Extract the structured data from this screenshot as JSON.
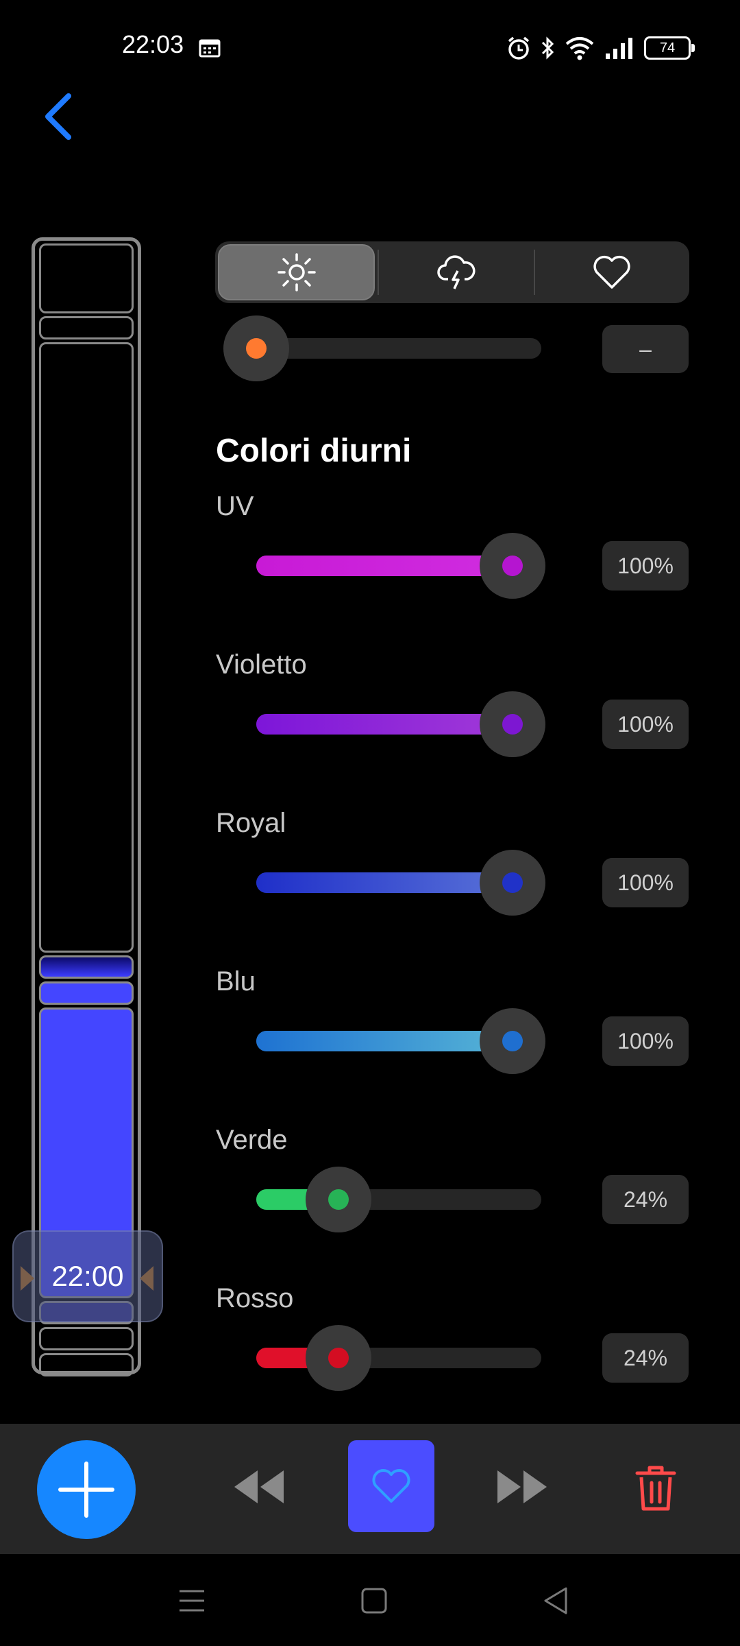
{
  "status_bar": {
    "time": "22:03",
    "battery": "74"
  },
  "timeline": {
    "current_time": "22:00"
  },
  "tabs": [
    {
      "icon": "sun-icon",
      "active": true
    },
    {
      "icon": "storm-icon",
      "active": false
    },
    {
      "icon": "heart-icon",
      "active": false
    }
  ],
  "top_slider": {
    "value": "–",
    "knob_color": "#ff7a30"
  },
  "section_title": "Colori diurni",
  "channels": [
    {
      "label": "UV",
      "value": "100%",
      "fraction": 1.0,
      "color_start": "#c81ad6",
      "color_end": "#d02de0",
      "knob_color": "#b515d0"
    },
    {
      "label": "Violetto",
      "value": "100%",
      "fraction": 1.0,
      "color_start": "#7d16d9",
      "color_end": "#a23ad8",
      "knob_color": "#7d17d2"
    },
    {
      "label": "Royal",
      "value": "100%",
      "fraction": 1.0,
      "color_start": "#1f2fc9",
      "color_end": "#5a73d8",
      "knob_color": "#2032c8"
    },
    {
      "label": "Blu",
      "value": "100%",
      "fraction": 1.0,
      "color_start": "#1e72d2",
      "color_end": "#58b6d6",
      "knob_color": "#1f6fd0"
    },
    {
      "label": "Verde",
      "value": "24%",
      "fraction": 0.24,
      "color_start": "#2bcc66",
      "color_end": "#2bcc66",
      "knob_color": "#27b356"
    },
    {
      "label": "Rosso",
      "value": "24%",
      "fraction": 0.24,
      "color_start": "#e0102a",
      "color_end": "#e0102a",
      "knob_color": "#d40d22"
    }
  ],
  "toolbar": {
    "add": "plus-icon",
    "rewind": "rewind-icon",
    "favorite": "heart-icon",
    "forward": "fast-forward-icon",
    "delete": "trash-icon"
  }
}
